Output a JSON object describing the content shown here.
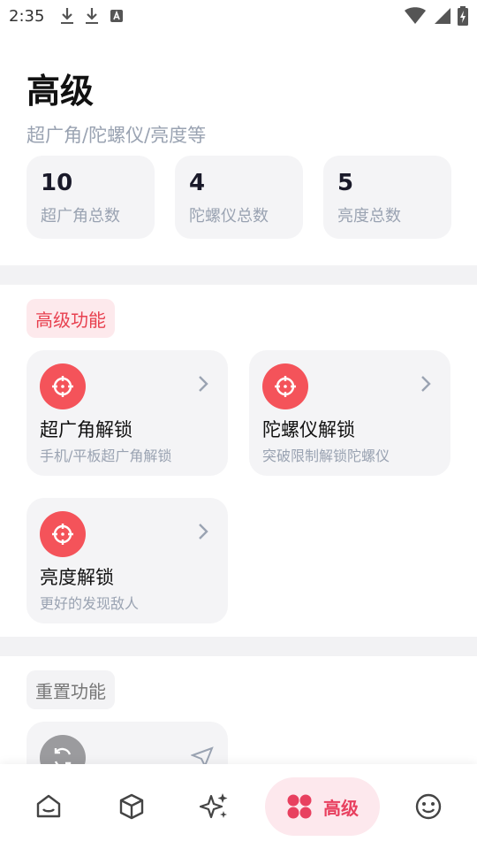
{
  "status_bar": {
    "time": "2:35"
  },
  "header": {
    "title": "高级",
    "subtitle": "超广角/陀螺仪/亮度等"
  },
  "stats": [
    {
      "value": "10",
      "label": "超广角总数"
    },
    {
      "value": "4",
      "label": "陀螺仪总数"
    },
    {
      "value": "5",
      "label": "亮度总数"
    }
  ],
  "advanced_section": {
    "tag": "高级功能",
    "items": [
      {
        "title": "超广角解锁",
        "desc": "手机/平板超广角解锁"
      },
      {
        "title": "陀螺仪解锁",
        "desc": "突破限制解锁陀螺仪"
      },
      {
        "title": "亮度解锁",
        "desc": "更好的发现敌人"
      }
    ]
  },
  "reset_section": {
    "tag": "重置功能"
  },
  "bottom_nav": {
    "active_label": "高级"
  },
  "colors": {
    "accent": "#f4535a",
    "active_nav": "#e8405f",
    "muted": "#9aa3b2"
  }
}
